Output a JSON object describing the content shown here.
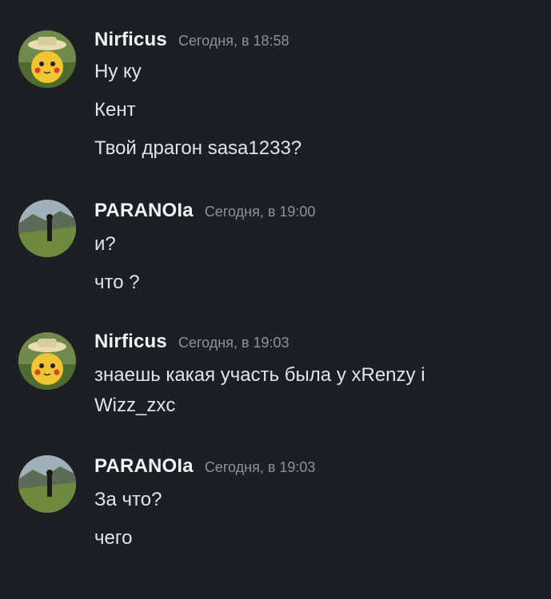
{
  "messages": [
    {
      "author": "Nirficus",
      "timestamp": "Сегодня, в 18:58",
      "avatar": "pikachu-detective-avatar",
      "lines": [
        "Ну ку",
        "Кент",
        "Твой драгон sasa1233?"
      ]
    },
    {
      "author": "PARANOIa",
      "timestamp": "Сегодня, в 19:00",
      "avatar": "mountain-figure-avatar",
      "lines": [
        "и?",
        "что ?"
      ]
    },
    {
      "author": "Nirficus",
      "timestamp": "Сегодня, в 19:03",
      "avatar": "pikachu-detective-avatar",
      "lines": [
        "знаешь какая участь была у xRenzy i",
        "Wizz_zxc"
      ]
    },
    {
      "author": "PARANOIa",
      "timestamp": "Сегодня, в 19:03",
      "avatar": "mountain-figure-avatar",
      "lines": [
        "За что?",
        "чего"
      ]
    }
  ],
  "colors": {
    "background": "#1e1f24",
    "username": "#f2f3f5",
    "timestamp": "#8e9297",
    "message_text": "#e3e4e8"
  }
}
